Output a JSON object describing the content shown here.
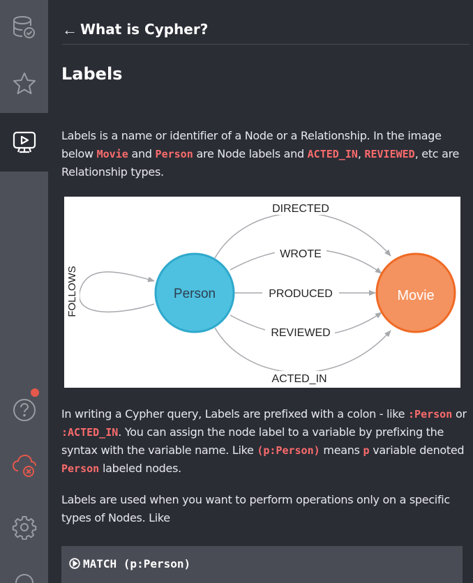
{
  "sidebar": {
    "items": [
      {
        "name": "database-icon"
      },
      {
        "name": "favorites-icon"
      },
      {
        "name": "guides-icon"
      },
      {
        "name": "help-icon"
      },
      {
        "name": "sync-error-icon"
      },
      {
        "name": "settings-icon"
      }
    ],
    "notification_color": "#e5584c"
  },
  "drawer": {
    "back_icon": "←",
    "title": "What is Cypher?"
  },
  "section": {
    "title": "Labels",
    "p1": {
      "t1": "Labels is a name or identifier of a Node or a Relationship. In the image below ",
      "c1": "Movie",
      "t2": " and ",
      "c2": "Person",
      "t3": " are Node labels and ",
      "c3": "ACTED_IN",
      "t4": ", ",
      "c4": "REVIEWED",
      "t5": ", etc are Relationship types."
    },
    "p2": {
      "t1": "In writing a Cypher query, Labels are prefixed with a colon - like ",
      "c1": ":Person",
      "t2": " or ",
      "c2": ":ACTED_IN",
      "t3": ". You can assign the node label to a variable by prefixing the syntax with the variable name. Like ",
      "c3": "(p:Person)",
      "t4": " means ",
      "c4": "p",
      "t5": " variable denoted ",
      "c5": "Person",
      "t6": " labeled nodes."
    },
    "p3": "Labels are used when you want to perform operations only on a specific types of Nodes. Like",
    "code": "MATCH (p:Person)"
  },
  "diagram": {
    "node_person": "Person",
    "node_movie": "Movie",
    "rel_directed": "DIRECTED",
    "rel_wrote": "WROTE",
    "rel_produced": "PRODUCED",
    "rel_reviewed": "REVIEWED",
    "rel_acted_in": "ACTED_IN",
    "rel_follows": "FOLLOWS",
    "person_color": "#4fc1e0",
    "movie_color": "#f4935f"
  },
  "colors": {
    "code_text": "#fb6c6c",
    "sidebar_bg": "#4e5059",
    "drawer_bg": "#2b2d35"
  }
}
